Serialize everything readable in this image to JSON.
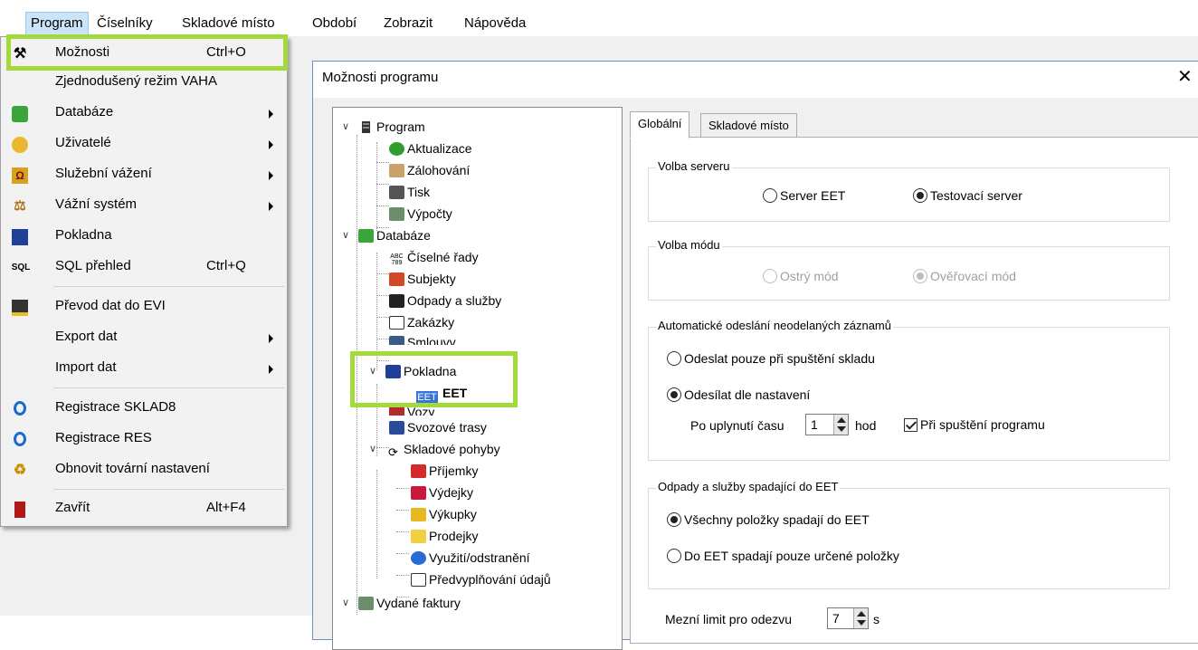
{
  "menubar": {
    "items": [
      "Program",
      "Číselníky",
      "Skladové místo",
      "Období",
      "Zobrazit",
      "Nápověda"
    ]
  },
  "program_menu": {
    "items": [
      {
        "label": "Možnosti",
        "shortcut": "Ctrl+O",
        "icon": "tools-icon"
      },
      {
        "label": "Zjednodušený režim VAHA",
        "icon": ""
      },
      {
        "label": "Databáze",
        "icon": "database-icon",
        "submenu": true
      },
      {
        "label": "Uživatelé",
        "icon": "users-icon",
        "submenu": true
      },
      {
        "label": "Služební vážení",
        "icon": "service-weighing-icon",
        "submenu": true
      },
      {
        "label": "Vážní systém",
        "icon": "scale-icon",
        "submenu": true
      },
      {
        "label": "Pokladna",
        "icon": "cash-register-icon"
      },
      {
        "label": "SQL přehled",
        "shortcut": "Ctrl+Q",
        "icon": "sql-icon",
        "icon_text": "SQL"
      },
      {
        "label": "Převod dat do EVI",
        "icon": "data-transfer-icon"
      },
      {
        "label": "Export dat",
        "submenu": true
      },
      {
        "label": "Import dat",
        "submenu": true
      },
      {
        "label": "Registrace SKLAD8",
        "icon": "registration-icon"
      },
      {
        "label": "Registrace RES",
        "icon": "registration-icon"
      },
      {
        "label": "Obnovit tovární nastavení",
        "icon": "reset-icon"
      },
      {
        "label": "Zavřít",
        "shortcut": "Alt+F4",
        "icon": "exit-icon"
      }
    ]
  },
  "dialog": {
    "title": "Možnosti programu",
    "close_glyph": "✕",
    "tree": {
      "program": "Program",
      "aktualizace": "Aktualizace",
      "zalohovani": "Zálohování",
      "tisk": "Tisk",
      "vypocty": "Výpočty",
      "databaze": "Databáze",
      "ciselne_rady": "Číselné řady",
      "subjekty": "Subjekty",
      "odpady": "Odpady a služby",
      "zakazky": "Zakázky",
      "smlouvy": "Smlouvy",
      "pokladna": "Pokladna",
      "eet": "EET",
      "eet_icon_text": "EET",
      "vozy": "Vozy",
      "svozove_trasy": "Svozové trasy",
      "skladove_pohyby": "Skladové pohyby",
      "prijemky": "Příjemky",
      "vydejky": "Výdejky",
      "vykupky": "Výkupky",
      "prodejky": "Prodejky",
      "vyuziti": "Využití/odstranění",
      "predvyplnovani": "Předvyplňování údajů",
      "vydane_faktury": "Vydané faktury"
    },
    "tabs": [
      "Globální",
      "Skladové místo"
    ],
    "server_group": {
      "legend": "Volba serveru",
      "options": [
        "Server EET",
        "Testovací server"
      ],
      "selected": "Testovací server"
    },
    "mode_group": {
      "legend": "Volba módu",
      "options": [
        "Ostrý mód",
        "Ověřovací mód"
      ],
      "selected": "Ověřovací mód",
      "disabled": true
    },
    "auto_send_group": {
      "legend": "Automatické odeslání neodelaných záznamů",
      "options": [
        "Odeslat pouze při spuštění skladu",
        "Odesílat dle nastavení"
      ],
      "selected": "Odesílat dle nastavení",
      "after_time_label": "Po uplynutí času",
      "after_time_value": "1",
      "after_time_unit": "hod",
      "on_start_label": "Při spuštění programu",
      "on_start_checked": true
    },
    "waste_group": {
      "legend": "Odpady a služby spadající do EET",
      "options": [
        "Všechny položky spadají do EET",
        "Do EET spadají pouze určené položky"
      ],
      "selected": "Všechny položky spadají do EET"
    },
    "limit": {
      "label": "Mezní limit pro odezvu",
      "value": "7",
      "unit": "s"
    }
  },
  "colors": {
    "highlight": "#a3d93a",
    "menu_active": "#cce4f7",
    "tree_selection": "#3875d7"
  }
}
